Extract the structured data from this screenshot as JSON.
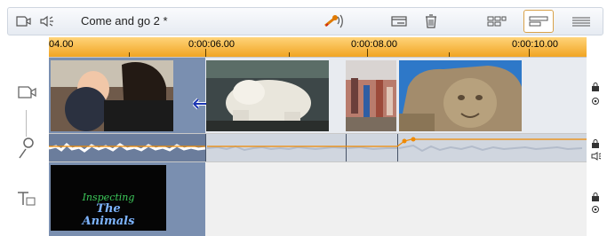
{
  "toolbar": {
    "project_title": "Come and go 2 *",
    "icons": [
      "camera-track-icon",
      "speaker-volume-icon",
      "scissors-audio-icon",
      "clip-properties-icon",
      "trash-icon",
      "storyboard-view-icon",
      "timeline-view-icon",
      "text-view-icon"
    ],
    "accent": "#f0a21f"
  },
  "ruler": {
    "labels": [
      "04.00",
      "0:00:06.00",
      "0:00:08.00",
      "0:00:10.00"
    ]
  },
  "tracks": {
    "video": {
      "clips": [
        "baby-and-mother",
        "polar-bear",
        "people-playground",
        "stone-statue"
      ]
    },
    "title": {
      "lines": [
        "Inspecting",
        "The",
        "Animals"
      ]
    }
  },
  "colors": {
    "ruler": "#f0a21f",
    "selected_clip": "#7a8fb0",
    "audio_line": "#f08a00",
    "title_green": "#3cc85a",
    "title_blue": "#7db4ff"
  }
}
